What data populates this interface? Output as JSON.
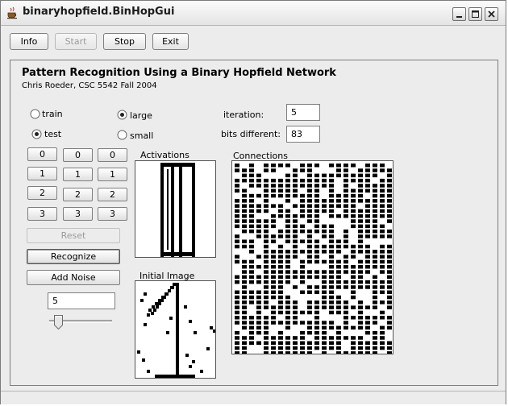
{
  "window": {
    "title": "binaryhopfield.BinHopGui"
  },
  "toolbar": {
    "info": "Info",
    "start": "Start",
    "stop": "Stop",
    "exit": "Exit"
  },
  "header": {
    "title": "Pattern Recognition Using a Binary Hopfield Network",
    "subtitle": "Chris Roeder, CSC 5542 Fall 2004"
  },
  "mode": {
    "train": "train",
    "test": "test",
    "selected": "test"
  },
  "size": {
    "large": "large",
    "small": "small",
    "selected": "large"
  },
  "stats": {
    "iteration_label": "iteration:",
    "iteration_value": "5",
    "bits_label": "bits different:",
    "bits_value": "83"
  },
  "digit_buttons": [
    [
      "0",
      "0",
      "0"
    ],
    [
      "1",
      "1",
      "1"
    ],
    [
      "2",
      "2",
      "2"
    ],
    [
      "3",
      "3",
      "3"
    ]
  ],
  "actions": {
    "reset": "Reset",
    "recognize": "Recognize",
    "add_noise": "Add Noise"
  },
  "noise": {
    "value": "5",
    "slider_fraction": 0.08
  },
  "panels": {
    "activations": "Activations",
    "initial_image": "Initial Image",
    "connections": "Connections"
  }
}
